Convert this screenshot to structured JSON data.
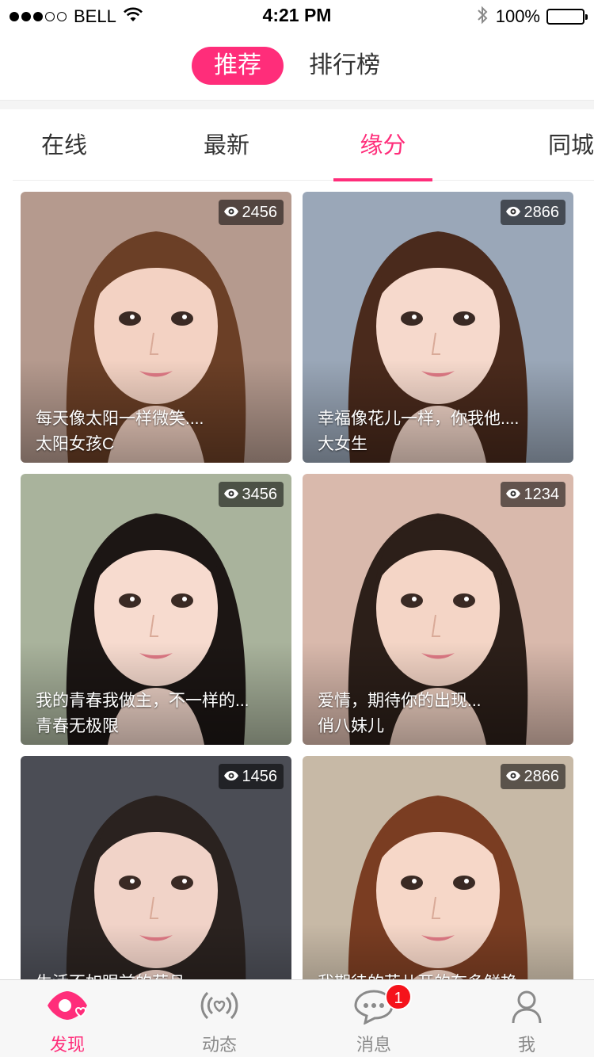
{
  "status_bar": {
    "carrier": "BELL",
    "time": "4:21 PM",
    "battery": "100%"
  },
  "top_segment": {
    "items": [
      {
        "label": "推荐",
        "active": true
      },
      {
        "label": "排行榜",
        "active": false
      }
    ]
  },
  "category_tabs": [
    {
      "label": "在线",
      "active": false
    },
    {
      "label": "最新",
      "active": false
    },
    {
      "label": "缘分",
      "active": true
    },
    {
      "label": "同城",
      "active": false
    }
  ],
  "cards": [
    {
      "views": "2456",
      "motto": "每天像太阳一样微笑....",
      "name": "太阳女孩C",
      "bg": "#b59a8e",
      "hair": "#6b3f26",
      "skin": "#f3d2c3"
    },
    {
      "views": "2866",
      "motto": "幸福像花儿一样，你我他....",
      "name": "大女生",
      "bg": "#9aa7b8",
      "hair": "#4a2a1c",
      "skin": "#f6d9cc"
    },
    {
      "views": "3456",
      "motto": "我的青春我做主，不一样的...",
      "name": "青春无极限",
      "bg": "#a9b39c",
      "hair": "#1c1614",
      "skin": "#f7dbcf"
    },
    {
      "views": "1234",
      "motto": "爱情，期待你的出现...",
      "name": "俏八妹儿",
      "bg": "#d9b9ac",
      "hair": "#2c1f19",
      "skin": "#f4d5c6"
    },
    {
      "views": "1456",
      "motto": "生活不如眼前的苟且",
      "name": "",
      "bg": "#4b4d55",
      "hair": "#2a221f",
      "skin": "#f1d3c8"
    },
    {
      "views": "2866",
      "motto": "我期待的花儿开的有多鲜艳",
      "name": "",
      "bg": "#c7b9a6",
      "hair": "#7a3d22",
      "skin": "#f6d7c8"
    }
  ],
  "tab_bar": [
    {
      "label": "发现",
      "icon": "discover-eye-heart-icon",
      "active": true
    },
    {
      "label": "动态",
      "icon": "broadcast-heart-icon",
      "active": false
    },
    {
      "label": "消息",
      "icon": "chat-bubble-icon",
      "active": false,
      "badge": "1"
    },
    {
      "label": "我",
      "icon": "person-icon",
      "active": false
    }
  ],
  "colors": {
    "accent": "#ff2d7a",
    "badge": "#f5131b",
    "tab_inactive": "#8a8a8a"
  }
}
